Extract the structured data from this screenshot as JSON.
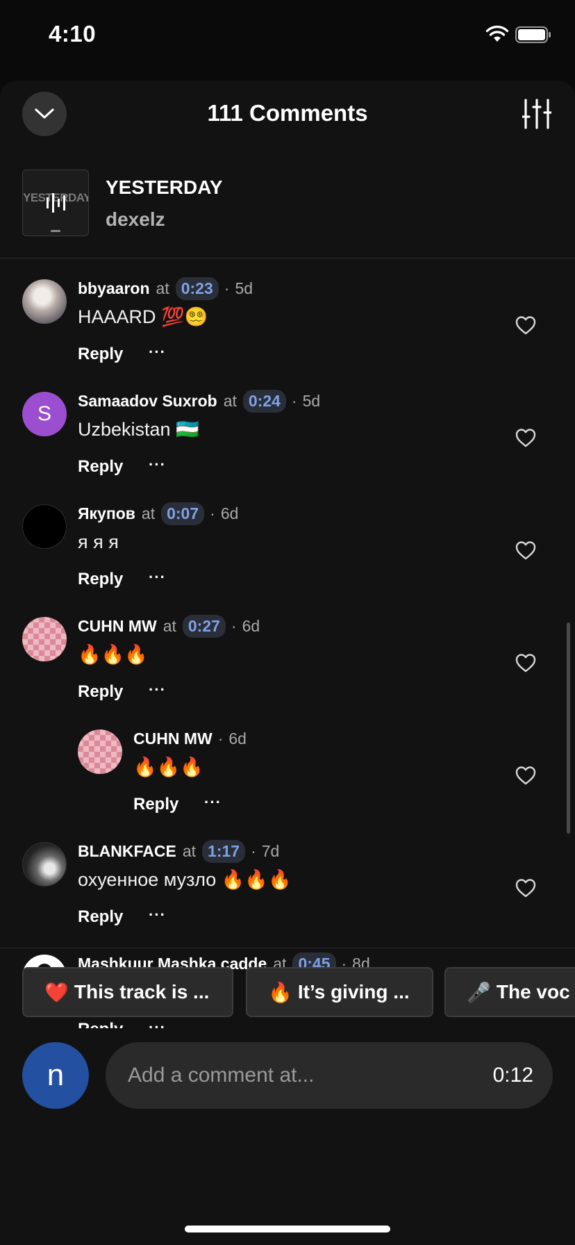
{
  "status_bar": {
    "time": "4:10"
  },
  "header": {
    "title": "111 Comments"
  },
  "track": {
    "title": "YESTERDAY",
    "artist": "dexelz",
    "art_text": "YESTERDAY"
  },
  "comments": [
    {
      "user": "bbyaaron",
      "at": "at",
      "timestamp": "0:23",
      "age": "5d",
      "text": "HAAARD 💯😵‍💫",
      "reply": "Reply",
      "more": "···"
    },
    {
      "user": "Samaadov Suxrob",
      "at": "at",
      "timestamp": "0:24",
      "age": "5d",
      "text": "Uzbekistan 🇺🇿",
      "reply": "Reply",
      "more": "···",
      "avatar_letter": "S"
    },
    {
      "user": "Якупов",
      "at": "at",
      "timestamp": "0:07",
      "age": "6d",
      "text": "я я я",
      "reply": "Reply",
      "more": "···"
    },
    {
      "user": "CUHN MW",
      "at": "at",
      "timestamp": "0:27",
      "age": "6d",
      "text": "🔥🔥🔥",
      "reply": "Reply",
      "more": "···"
    },
    {
      "user": "CUHN MW",
      "age": "6d",
      "text": "🔥🔥🔥",
      "reply": "Reply",
      "more": "···",
      "is_reply": true
    },
    {
      "user": "BLANKFACE",
      "at": "at",
      "timestamp": "1:17",
      "age": "7d",
      "text": "охуенное музло 🔥🔥🔥",
      "reply": "Reply",
      "more": "···"
    },
    {
      "user": "Mashkuur Mashka cadde",
      "at": "at",
      "timestamp": "0:45",
      "age": "8d",
      "text": "👍",
      "reply": "Reply",
      "more": "···"
    }
  ],
  "suggestions": [
    {
      "emoji": "❤️",
      "label": "This track is ..."
    },
    {
      "emoji": "🔥",
      "label": "It’s giving ..."
    },
    {
      "emoji": "🎤",
      "label": "The voc"
    }
  ],
  "composer": {
    "avatar_letter": "n",
    "placeholder": "Add a comment at...",
    "time": "0:12"
  },
  "colors": {
    "timestamp": "#7fa2e6",
    "avatar_purple": "#9b4fd0",
    "user_avatar": "#2350a0"
  },
  "icons": {
    "collapse": "chevron-down-icon",
    "filter": "sliders-icon",
    "like": "heart-icon",
    "more": "ellipsis-icon"
  }
}
